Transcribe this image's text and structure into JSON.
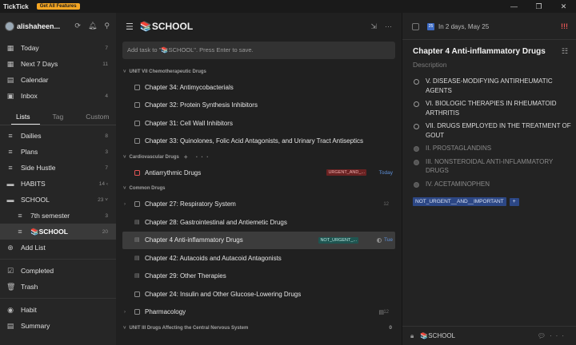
{
  "app": {
    "name": "TickTick",
    "promo": "Get All Features"
  },
  "window_controls": [
    "—",
    "❐",
    "✕"
  ],
  "sidebar": {
    "user": {
      "name": "alishaheen..."
    },
    "smart": [
      {
        "label": "Today",
        "count": "7",
        "icon": "calendar-today-icon"
      },
      {
        "label": "Next 7 Days",
        "count": "11",
        "icon": "calendar-week-icon"
      },
      {
        "label": "Calendar",
        "count": "",
        "icon": "calendar-icon"
      },
      {
        "label": "Inbox",
        "count": "4",
        "icon": "inbox-icon"
      }
    ],
    "tabs": [
      "Lists",
      "Tag",
      "Custom"
    ],
    "lists": [
      {
        "label": "Dailies",
        "count": "8",
        "icon": "list-icon"
      },
      {
        "label": "Plans",
        "count": "3",
        "icon": "list-icon"
      },
      {
        "label": "Side Hustle",
        "count": "7",
        "icon": "list-icon"
      },
      {
        "label": "HABITS",
        "count": "14 ‹",
        "icon": "folder-icon"
      },
      {
        "label": "SCHOOL",
        "count": "23 ˅",
        "icon": "folder-icon"
      },
      {
        "label": "7th semester",
        "count": "3",
        "icon": "list-icon"
      },
      {
        "label": "📚SCHOOL",
        "count": "20",
        "icon": "list-icon"
      }
    ],
    "add_list": "Add List",
    "system": [
      {
        "label": "Completed",
        "icon": "check-square-icon"
      },
      {
        "label": "Trash",
        "icon": "trash-icon"
      }
    ],
    "bottom": [
      {
        "label": "Habit",
        "icon": "habit-icon"
      },
      {
        "label": "Summary",
        "icon": "summary-icon"
      }
    ]
  },
  "main": {
    "title": "📚SCHOOL",
    "add_placeholder": "Add task to \"📚SCHOOL\". Press Enter to save.",
    "groups": [
      {
        "name": "UNIT VII Chemotherapeutic Drugs",
        "count": "",
        "tasks": [
          {
            "title": "Chapter 34: Antimycobacterials"
          },
          {
            "title": "Chapter 32: Protein Synthesis Inhibitors"
          },
          {
            "title": "Chapter 31: Cell Wall Inhibitors"
          },
          {
            "title": "Chapter 33: Quinolones, Folic Acid Antagonists, and Urinary Tract Antiseptics"
          }
        ]
      },
      {
        "name": "Cardiovascular Drugs",
        "count": "",
        "extra": "+ ···",
        "tasks": [
          {
            "title": "Antiarrythmic Drugs",
            "tag": "URGENT_AND_...",
            "date": "Today",
            "red": true
          }
        ]
      },
      {
        "name": "Common Drugs",
        "count": "",
        "tasks": [
          {
            "title": "Chapter 27: Respiratory System",
            "sub": "12",
            "chev": true
          },
          {
            "title": "Chapter 28: Gastrointestinal and Antiemetic Drugs",
            "note": true
          },
          {
            "title": "Chapter 4 Anti-inflammatory Drugs",
            "note": true,
            "tag": "NOT_URGENT_...",
            "date": "Tue",
            "selected": true
          },
          {
            "title": "Chapter 42: Autacoids and Autacoid Antagonists",
            "note": true
          },
          {
            "title": "Chapter 29: Other Therapies",
            "note": true
          },
          {
            "title": "Chapter 24: Insulin and Other Glucose-Lowering Drugs"
          },
          {
            "title": "Pharmacology",
            "sub": "12",
            "chev": true,
            "notemark": true
          }
        ]
      },
      {
        "name": "UNIT III Drugs Affecting the Central Nervous System",
        "count": "0",
        "tasks": []
      }
    ]
  },
  "detail": {
    "date": "In 2 days, May 25",
    "priority": "!!!",
    "title": "Chapter 4 Anti-inflammatory Drugs",
    "description_label": "Description",
    "checklist": [
      {
        "text": "V.  DISEASE-MODIFYING ANTIRHEUMATIC AGENTS",
        "done": false
      },
      {
        "text": "VI.  BIOLOGIC THERAPIES IN RHEUMATOID ARTHRITIS",
        "done": false
      },
      {
        "text": "VII.  DRUGS EMPLOYED IN THE TREATMENT OF GOUT",
        "done": false
      },
      {
        "text": "II.  PROSTAGLANDINS",
        "done": true
      },
      {
        "text": "III.  NONSTEROIDAL ANTI-INFLAMMATORY DRUGS",
        "done": true
      },
      {
        "text": "IV.  ACETAMINOPHEN",
        "done": true
      }
    ],
    "tag": "NOT_URGENT__AND__IMPORTANT",
    "tag_add": "+",
    "footer_list": "📚SCHOOL"
  },
  "colors": {
    "accent": "#3d6bc4",
    "urgent": "#6a2222",
    "not_urgent": "#1f5551",
    "priority": "#e05454"
  }
}
